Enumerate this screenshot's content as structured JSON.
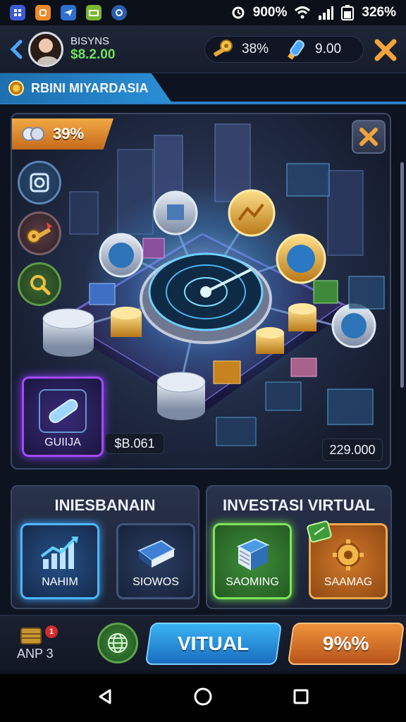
{
  "status_bar": {
    "apps": [
      {
        "icon": "app-icon-blue",
        "color": "#3c5bd6"
      },
      {
        "icon": "app-icon-orange",
        "color": "#f08a2a"
      },
      {
        "icon": "app-icon-send",
        "color": "#2f6fd0"
      },
      {
        "icon": "app-icon-green",
        "color": "#7ab634"
      },
      {
        "icon": "app-icon-shield",
        "color": "#2a5db0"
      }
    ],
    "alarm_level": "900%",
    "battery_text": "326%"
  },
  "header": {
    "player_name": "BISYNS",
    "balance": "$8.2.00",
    "resource_1": "38%",
    "resource_2": "9.00"
  },
  "section_tab": {
    "label": "RBINI MIYARDASIA"
  },
  "main_panel": {
    "banner_percent": "39%",
    "guide_label": "GUIIJA",
    "value_left": "$B.061",
    "value_right": "229.000"
  },
  "left_panel": {
    "title": "INIESBANAIN",
    "tiles": [
      {
        "label": "NAHIM",
        "icon": "growth-chart-icon"
      },
      {
        "label": "SIOWOS",
        "icon": "book-icon"
      }
    ]
  },
  "right_panel": {
    "title": "INVESTASI VIRTUAL",
    "tiles": [
      {
        "label": "SAOMING",
        "icon": "server-icon"
      },
      {
        "label": "SAAMAG",
        "icon": "gear-icon"
      }
    ]
  },
  "action_bar": {
    "ap_label": "ANP 3",
    "ap_badge": "1",
    "virtual_button": "VITUAL",
    "percent_button": "9%%"
  },
  "colors": {
    "accent_blue": "#2a8ed6",
    "accent_green": "#6fe05a",
    "accent_orange": "#f0923c"
  }
}
